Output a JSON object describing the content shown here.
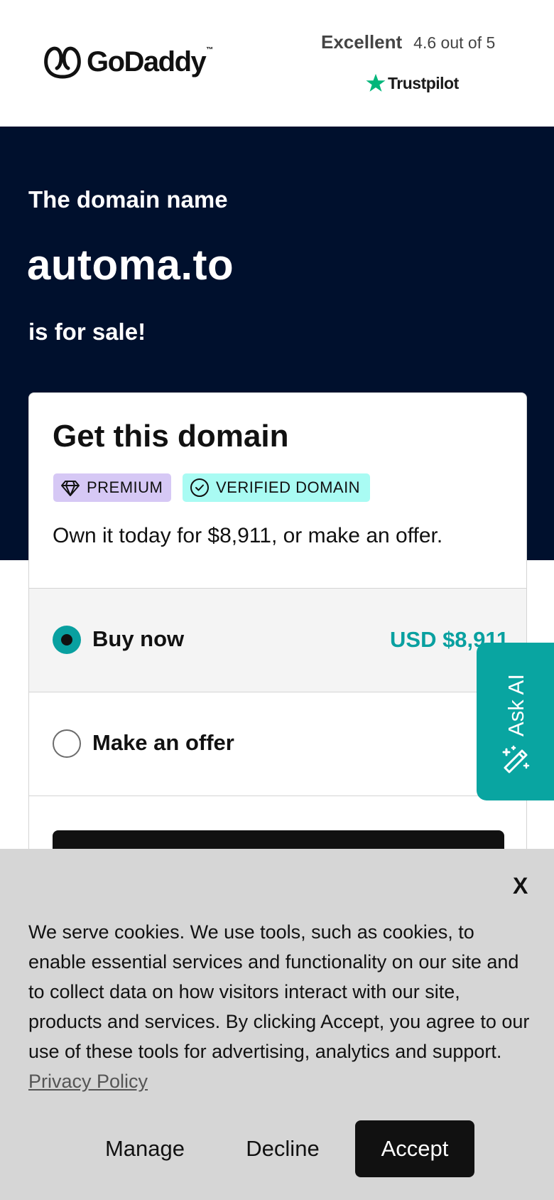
{
  "header": {
    "brand": "GoDaddy",
    "brand_tm": "™",
    "rating_word": "Excellent",
    "rating_score": "4.6 out of 5",
    "trustpilot_label": "Trustpilot"
  },
  "hero": {
    "pre_text": "The domain name",
    "domain": "automa.to",
    "post_text": "is for sale!"
  },
  "card": {
    "title": "Get this domain",
    "badges": [
      {
        "label": "PREMIUM",
        "icon": "diamond-icon"
      },
      {
        "label": "VERIFIED DOMAIN",
        "icon": "check-circle-icon"
      }
    ],
    "description": "Own it today for $8,911, or make an offer.",
    "options": [
      {
        "label": "Buy now",
        "price": "USD $8,911",
        "selected": true
      },
      {
        "label": "Make an offer",
        "selected": false
      }
    ]
  },
  "ask_ai": {
    "label": "Ask AI",
    "icon": "magic-wand-icon"
  },
  "cookie": {
    "close_label": "X",
    "text": "We serve cookies. We use tools, such as cookies, to enable essential services and functionality on our site and to collect data on how visitors interact with our site, products and services. By clicking Accept, you agree to our use of these tools for advertising, analytics and support.",
    "link_label": "Privacy Policy",
    "manage_label": "Manage",
    "decline_label": "Decline",
    "accept_label": "Accept"
  },
  "colors": {
    "hero_bg": "#00102d",
    "accent_teal": "#09a0a0",
    "premium_badge": "#d6c8f5",
    "verified_badge": "#a9fbf3",
    "cookie_bg": "#d6d6d6"
  }
}
